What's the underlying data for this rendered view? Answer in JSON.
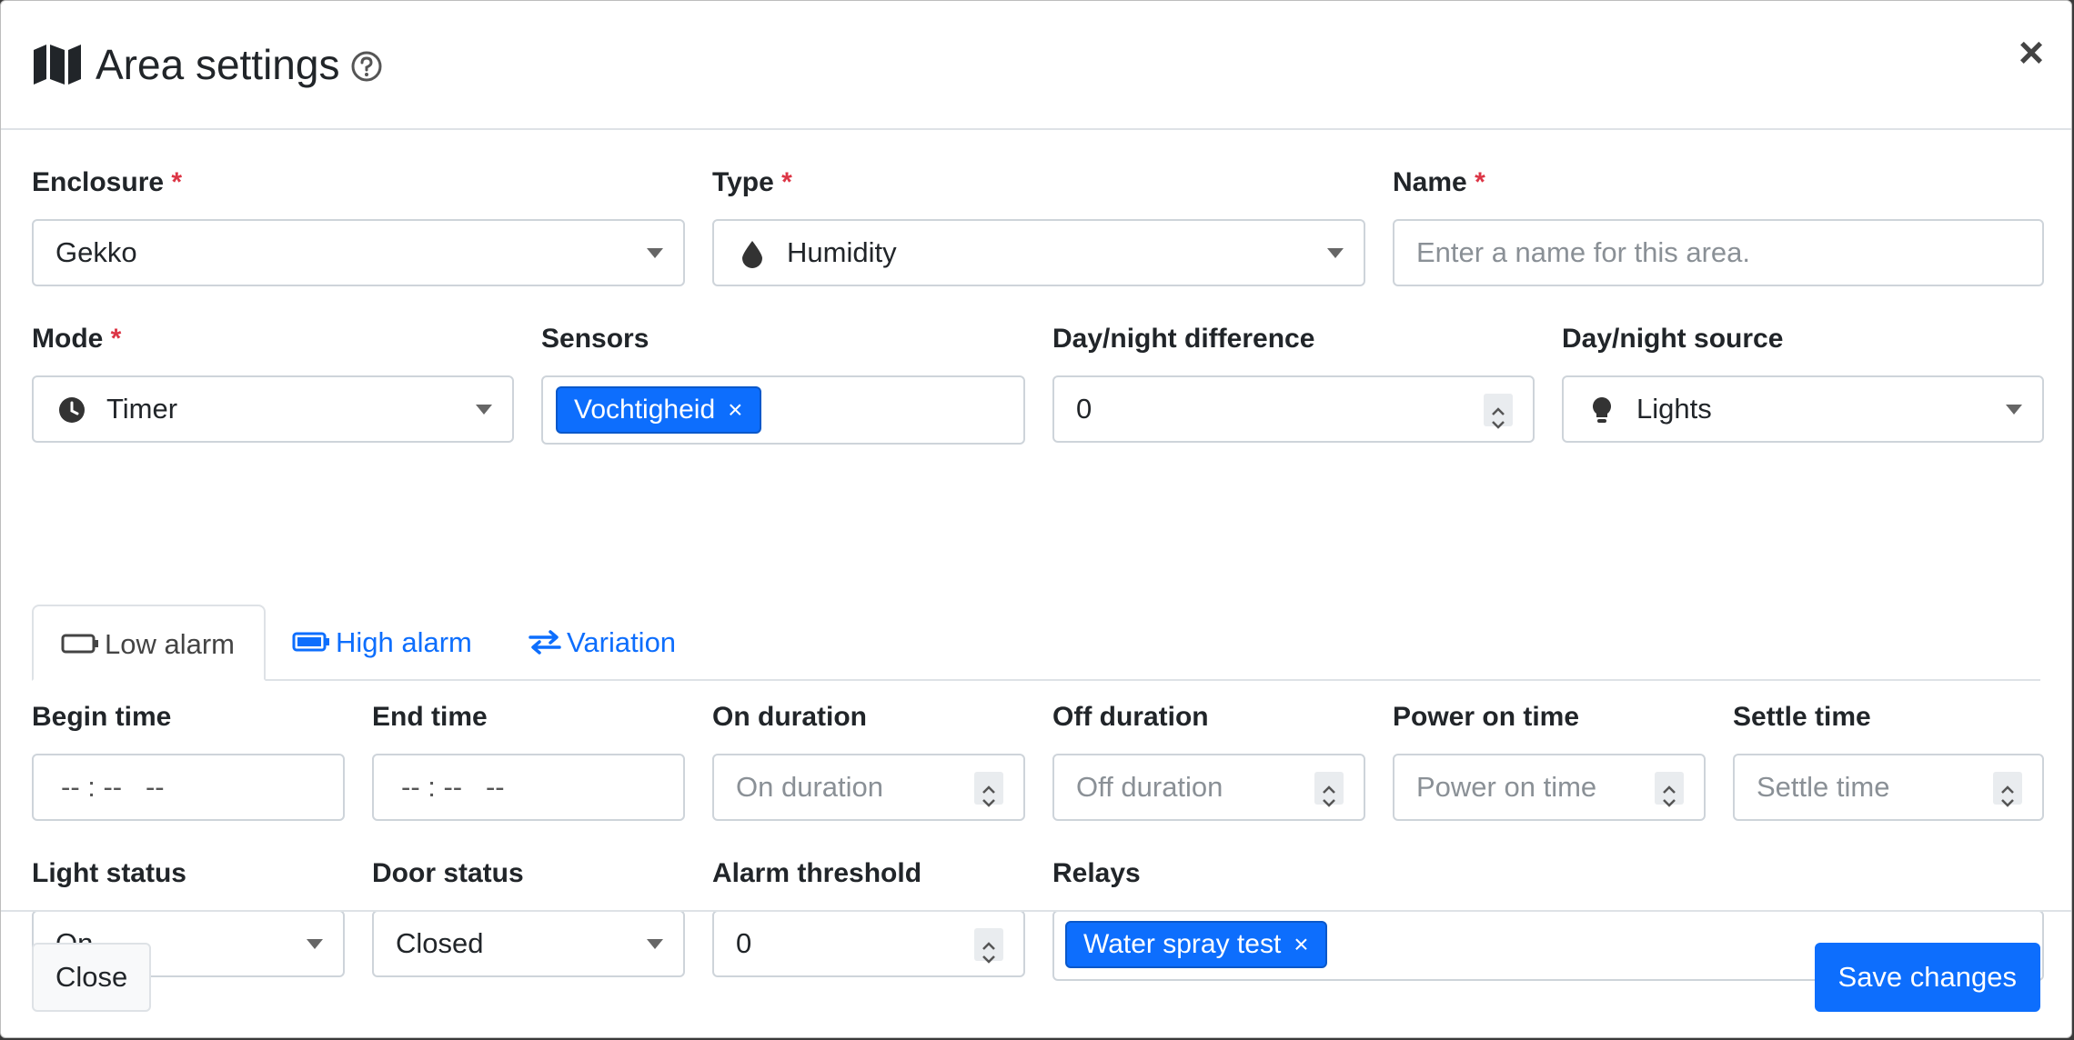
{
  "header": {
    "title": "Area settings"
  },
  "fields": {
    "enclosure": {
      "label": "Enclosure",
      "value": "Gekko"
    },
    "type": {
      "label": "Type",
      "value": "Humidity"
    },
    "name": {
      "label": "Name",
      "placeholder": "Enter a name for this area."
    },
    "mode": {
      "label": "Mode",
      "value": "Timer"
    },
    "sensors": {
      "label": "Sensors",
      "tags": [
        "Vochtigheid"
      ]
    },
    "day_night_difference": {
      "label": "Day/night difference",
      "value": "0"
    },
    "day_night_source": {
      "label": "Day/night source",
      "value": "Lights"
    }
  },
  "tabs": [
    {
      "label": "Low alarm",
      "active": true
    },
    {
      "label": "High alarm",
      "active": false
    },
    {
      "label": "Variation",
      "active": false
    }
  ],
  "alarm": {
    "begin_time": {
      "label": "Begin time",
      "value": "-- : --   --"
    },
    "end_time": {
      "label": "End time",
      "value": "-- : --   --"
    },
    "on_duration": {
      "label": "On duration",
      "placeholder": "On duration"
    },
    "off_duration": {
      "label": "Off duration",
      "placeholder": "Off duration"
    },
    "power_on_time": {
      "label": "Power on time",
      "placeholder": "Power on time"
    },
    "settle_time": {
      "label": "Settle time",
      "placeholder": "Settle time"
    },
    "light_status": {
      "label": "Light status",
      "value": "On"
    },
    "door_status": {
      "label": "Door status",
      "value": "Closed"
    },
    "alarm_threshold": {
      "label": "Alarm threshold",
      "value": "0"
    },
    "relays": {
      "label": "Relays",
      "tags": [
        "Water spray test"
      ]
    }
  },
  "footer": {
    "close_label": "Close",
    "save_label": "Save changes"
  },
  "colors": {
    "primary": "#0d6efd",
    "required": "#dc3545",
    "border": "#ced4da"
  },
  "icons": {
    "header": [
      "map-icon",
      "help-circle-icon",
      "close-icon"
    ],
    "type": "droplet-icon",
    "mode": "clock-icon",
    "source": "lightbulb-icon",
    "tabs": [
      "battery-empty-icon",
      "battery-full-icon",
      "swap-arrows-icon"
    ]
  }
}
